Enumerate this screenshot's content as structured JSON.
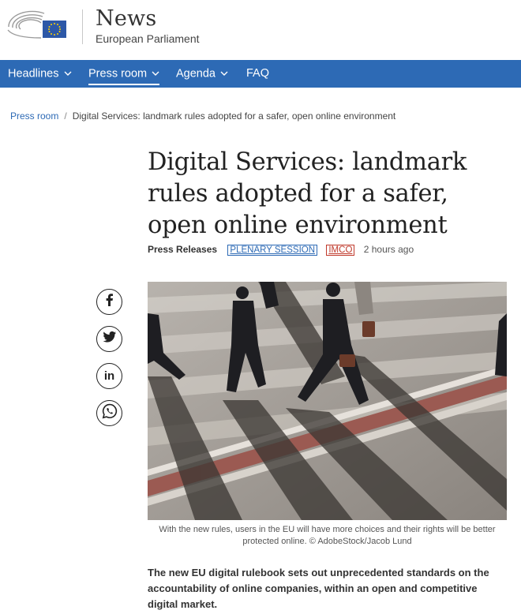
{
  "header": {
    "title": "News",
    "subtitle": "European Parliament",
    "logo_icon": "european-parliament-logo",
    "accent": "#2d6ab5"
  },
  "nav": {
    "items": [
      {
        "label": "Headlines",
        "has_dropdown": true
      },
      {
        "label": "Press room",
        "has_dropdown": true,
        "active": true
      },
      {
        "label": "Agenda",
        "has_dropdown": true
      },
      {
        "label": "FAQ",
        "has_dropdown": false
      }
    ]
  },
  "breadcrumb": {
    "parent": "Press room",
    "separator": "/",
    "current": "Digital Services: landmark rules adopted for a safer, open online environment"
  },
  "article": {
    "title": "Digital Services: landmark rules adopted for a safer, open online environment",
    "type": "Press Releases",
    "tags": [
      "PLENARY SESSION",
      "IMCO"
    ],
    "time": "2 hours ago",
    "image_caption": "With the new rules, users in the EU will have more choices and their rights will be better protected online. © AdobeStock/Jacob Lund",
    "lead": "The new EU digital rulebook sets out unprecedented standards on the accountability of online companies, within an open and competitive digital market."
  },
  "share": {
    "icons": [
      "facebook-icon",
      "twitter-icon",
      "linkedin-icon",
      "whatsapp-icon"
    ]
  }
}
